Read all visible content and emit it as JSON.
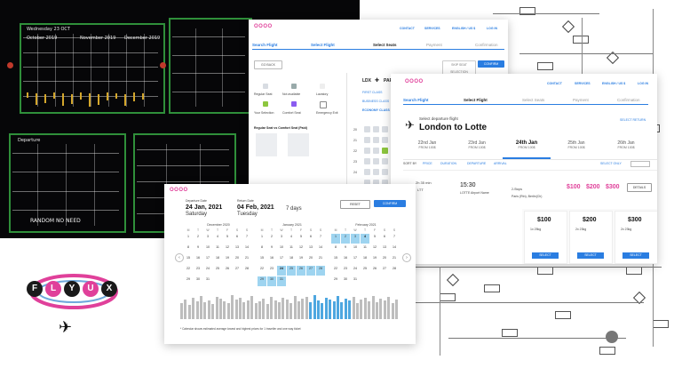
{
  "brand": {
    "name": "FLYUX",
    "logo_letters": [
      "F",
      "L",
      "Y",
      "U",
      "X"
    ],
    "accent": "#2a7de1",
    "pink": "#e0409a"
  },
  "sketch_boards": {
    "board1_text": [
      "Wednesday 23 OCT",
      "October 2019",
      "November 2019",
      "December 2019"
    ],
    "board2_text": [
      "Departure",
      "RANDOM NO NEED"
    ]
  },
  "screen_a": {
    "logo": "OOOO",
    "nav": [
      "CONTACT",
      "SERVICES",
      "ENGLISH / US $",
      "LOG IN"
    ],
    "steps": [
      "Search Flight",
      "Select Flight",
      "Select Seats",
      "Payment",
      "Confirmation"
    ],
    "back_button": "GO BACK",
    "skip_button": "SKIP SEAT SELECTION",
    "confirm_button": "CONFIRM",
    "legend": [
      "Regular Seat",
      "Not available",
      "Lavatory",
      "Your Selection",
      "Comfort Seat",
      "Emergency Exit"
    ],
    "route": {
      "from": "LDX",
      "to": "PAR"
    },
    "classes": [
      "FIRST CLASS",
      "BUSINESS CLASS",
      "ECONOMY CLASS"
    ],
    "compare_title": "Regular Seat vs Comfort Seat (Paid)",
    "rows": [
      "20",
      "21",
      "22",
      "23",
      "24"
    ]
  },
  "screen_b": {
    "logo": "OOOO",
    "nav": [
      "CONTACT",
      "SERVICES",
      "ENGLISH / US $",
      "LOG IN"
    ],
    "steps": [
      "Search Flight",
      "Select Flight",
      "Select Seats",
      "Payment",
      "Confirmation"
    ],
    "subtitle": "Select departure flight",
    "title": "London to Lotte",
    "select_flight_link": "SELECT RETURN",
    "dates": [
      {
        "label": "22nd Jan",
        "price": "FROM 100$"
      },
      {
        "label": "23rd Jan",
        "price": "FROM 100$"
      },
      {
        "label": "24th Jan",
        "price": "FROM 100$"
      },
      {
        "label": "25th Jan",
        "price": "FROM 100$"
      },
      {
        "label": "26th Jan",
        "price": "FROM 100$"
      }
    ],
    "sort_by": [
      "SORT BY",
      "PRICE",
      "DURATION",
      "DEPARTURE",
      "ARRIVAL"
    ],
    "select_only": "SELECT ONLY",
    "flight": {
      "depart": "15:30",
      "depart_airport": "LOTTE Airport Name",
      "duration": "2h 35 min",
      "arrive_code": "LTT",
      "stops": "2-Stops",
      "via": "Paris (Rtn), Berlin(Ch)"
    },
    "price_header": [
      "$100",
      "$200",
      "$300"
    ],
    "details_button": "DETAILS",
    "fares": [
      {
        "price": "$100",
        "bag": "1x 25kg",
        "select": "SELECT"
      },
      {
        "price": "$200",
        "bag": "2x 23kg",
        "select": "SELECT"
      },
      {
        "price": "$300",
        "bag": "2x 23kg",
        "select": "SELECT"
      }
    ]
  },
  "screen_c": {
    "logo": "OOOO",
    "departure_label": "Departure Date",
    "departure_date": "24 Jan, 2021",
    "departure_day": "Saturday",
    "return_label": "Return Date",
    "return_date": "04 Feb, 2021",
    "return_day": "Tuesday",
    "nights": "7 days",
    "reset_button": "RESET",
    "confirm_button": "CONFIRM",
    "months": [
      "December 2020",
      "January 2021",
      "February 2021"
    ],
    "weekdays": [
      "M",
      "T",
      "W",
      "T",
      "F",
      "S",
      "S"
    ],
    "footnote": "* Calendar shows estimated average lowest and highest prices for 1 traveller and one way ticket"
  }
}
